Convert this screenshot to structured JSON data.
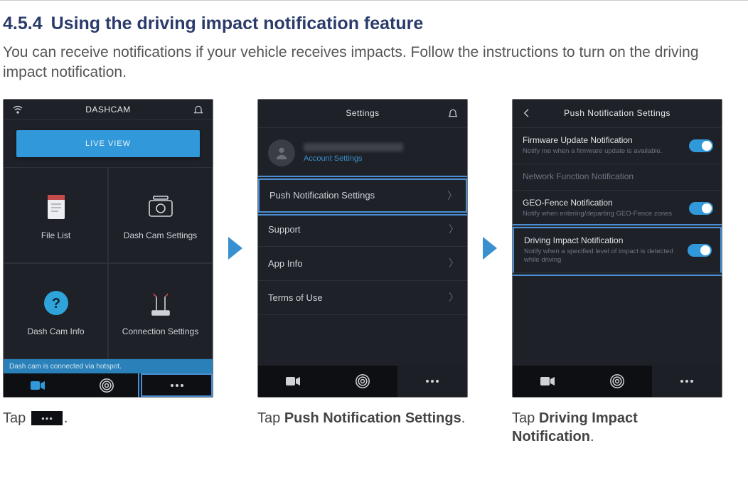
{
  "section": {
    "number": "4.5.4",
    "title": "Using the driving impact notification feature"
  },
  "intro": "You can receive notifications if your vehicle receives impacts. Follow the instructions to turn on the driving impact notification.",
  "screen1": {
    "title": "DASHCAM",
    "live": "LIVE VIEW",
    "cells": [
      "File List",
      "Dash Cam Settings",
      "Dash Cam Info",
      "Connection Settings"
    ],
    "status": "Dash cam is connected via hotspot."
  },
  "screen2": {
    "title": "Settings",
    "account_link": "Account Settings",
    "items": [
      "Push Notification Settings",
      "Support",
      "App Info",
      "Terms of Use"
    ]
  },
  "screen3": {
    "title": "Push Notification Settings",
    "items": [
      {
        "title": "Firmware Update Notification",
        "sub": "Notify me when a firmware update is available."
      },
      {
        "title": "Network Function Notification",
        "sub": ""
      },
      {
        "title": "GEO-Fence Notification",
        "sub": "Notify when entering/departing GEO-Fence zones"
      },
      {
        "title": "Driving Impact Notification",
        "sub": "Notify when a specified level of impact is detected while driving"
      }
    ]
  },
  "captions": {
    "c1a": "Tap ",
    "c1b": ".",
    "c2a": "Tap ",
    "c2b": "Push Notification Settings",
    "c2c": ".",
    "c3a": "Tap ",
    "c3b": "Driving Impact Notification",
    "c3c": "."
  }
}
